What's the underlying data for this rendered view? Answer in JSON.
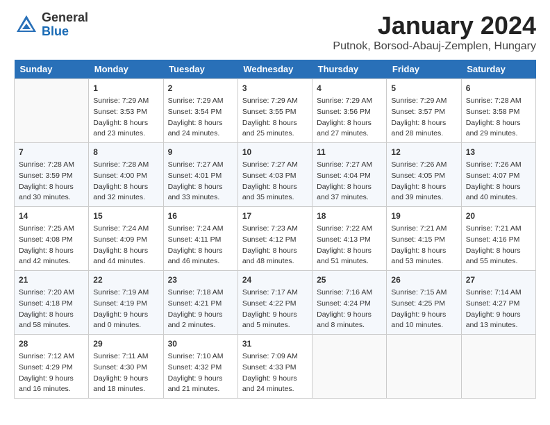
{
  "header": {
    "logo_general": "General",
    "logo_blue": "Blue",
    "month": "January 2024",
    "location": "Putnok, Borsod-Abauj-Zemplen, Hungary"
  },
  "weekdays": [
    "Sunday",
    "Monday",
    "Tuesday",
    "Wednesday",
    "Thursday",
    "Friday",
    "Saturday"
  ],
  "weeks": [
    [
      {
        "day": "",
        "sunrise": "",
        "sunset": "",
        "daylight": ""
      },
      {
        "day": "1",
        "sunrise": "Sunrise: 7:29 AM",
        "sunset": "Sunset: 3:53 PM",
        "daylight": "Daylight: 8 hours and 23 minutes."
      },
      {
        "day": "2",
        "sunrise": "Sunrise: 7:29 AM",
        "sunset": "Sunset: 3:54 PM",
        "daylight": "Daylight: 8 hours and 24 minutes."
      },
      {
        "day": "3",
        "sunrise": "Sunrise: 7:29 AM",
        "sunset": "Sunset: 3:55 PM",
        "daylight": "Daylight: 8 hours and 25 minutes."
      },
      {
        "day": "4",
        "sunrise": "Sunrise: 7:29 AM",
        "sunset": "Sunset: 3:56 PM",
        "daylight": "Daylight: 8 hours and 27 minutes."
      },
      {
        "day": "5",
        "sunrise": "Sunrise: 7:29 AM",
        "sunset": "Sunset: 3:57 PM",
        "daylight": "Daylight: 8 hours and 28 minutes."
      },
      {
        "day": "6",
        "sunrise": "Sunrise: 7:28 AM",
        "sunset": "Sunset: 3:58 PM",
        "daylight": "Daylight: 8 hours and 29 minutes."
      }
    ],
    [
      {
        "day": "7",
        "sunrise": "Sunrise: 7:28 AM",
        "sunset": "Sunset: 3:59 PM",
        "daylight": "Daylight: 8 hours and 30 minutes."
      },
      {
        "day": "8",
        "sunrise": "Sunrise: 7:28 AM",
        "sunset": "Sunset: 4:00 PM",
        "daylight": "Daylight: 8 hours and 32 minutes."
      },
      {
        "day": "9",
        "sunrise": "Sunrise: 7:27 AM",
        "sunset": "Sunset: 4:01 PM",
        "daylight": "Daylight: 8 hours and 33 minutes."
      },
      {
        "day": "10",
        "sunrise": "Sunrise: 7:27 AM",
        "sunset": "Sunset: 4:03 PM",
        "daylight": "Daylight: 8 hours and 35 minutes."
      },
      {
        "day": "11",
        "sunrise": "Sunrise: 7:27 AM",
        "sunset": "Sunset: 4:04 PM",
        "daylight": "Daylight: 8 hours and 37 minutes."
      },
      {
        "day": "12",
        "sunrise": "Sunrise: 7:26 AM",
        "sunset": "Sunset: 4:05 PM",
        "daylight": "Daylight: 8 hours and 39 minutes."
      },
      {
        "day": "13",
        "sunrise": "Sunrise: 7:26 AM",
        "sunset": "Sunset: 4:07 PM",
        "daylight": "Daylight: 8 hours and 40 minutes."
      }
    ],
    [
      {
        "day": "14",
        "sunrise": "Sunrise: 7:25 AM",
        "sunset": "Sunset: 4:08 PM",
        "daylight": "Daylight: 8 hours and 42 minutes."
      },
      {
        "day": "15",
        "sunrise": "Sunrise: 7:24 AM",
        "sunset": "Sunset: 4:09 PM",
        "daylight": "Daylight: 8 hours and 44 minutes."
      },
      {
        "day": "16",
        "sunrise": "Sunrise: 7:24 AM",
        "sunset": "Sunset: 4:11 PM",
        "daylight": "Daylight: 8 hours and 46 minutes."
      },
      {
        "day": "17",
        "sunrise": "Sunrise: 7:23 AM",
        "sunset": "Sunset: 4:12 PM",
        "daylight": "Daylight: 8 hours and 48 minutes."
      },
      {
        "day": "18",
        "sunrise": "Sunrise: 7:22 AM",
        "sunset": "Sunset: 4:13 PM",
        "daylight": "Daylight: 8 hours and 51 minutes."
      },
      {
        "day": "19",
        "sunrise": "Sunrise: 7:21 AM",
        "sunset": "Sunset: 4:15 PM",
        "daylight": "Daylight: 8 hours and 53 minutes."
      },
      {
        "day": "20",
        "sunrise": "Sunrise: 7:21 AM",
        "sunset": "Sunset: 4:16 PM",
        "daylight": "Daylight: 8 hours and 55 minutes."
      }
    ],
    [
      {
        "day": "21",
        "sunrise": "Sunrise: 7:20 AM",
        "sunset": "Sunset: 4:18 PM",
        "daylight": "Daylight: 8 hours and 58 minutes."
      },
      {
        "day": "22",
        "sunrise": "Sunrise: 7:19 AM",
        "sunset": "Sunset: 4:19 PM",
        "daylight": "Daylight: 9 hours and 0 minutes."
      },
      {
        "day": "23",
        "sunrise": "Sunrise: 7:18 AM",
        "sunset": "Sunset: 4:21 PM",
        "daylight": "Daylight: 9 hours and 2 minutes."
      },
      {
        "day": "24",
        "sunrise": "Sunrise: 7:17 AM",
        "sunset": "Sunset: 4:22 PM",
        "daylight": "Daylight: 9 hours and 5 minutes."
      },
      {
        "day": "25",
        "sunrise": "Sunrise: 7:16 AM",
        "sunset": "Sunset: 4:24 PM",
        "daylight": "Daylight: 9 hours and 8 minutes."
      },
      {
        "day": "26",
        "sunrise": "Sunrise: 7:15 AM",
        "sunset": "Sunset: 4:25 PM",
        "daylight": "Daylight: 9 hours and 10 minutes."
      },
      {
        "day": "27",
        "sunrise": "Sunrise: 7:14 AM",
        "sunset": "Sunset: 4:27 PM",
        "daylight": "Daylight: 9 hours and 13 minutes."
      }
    ],
    [
      {
        "day": "28",
        "sunrise": "Sunrise: 7:12 AM",
        "sunset": "Sunset: 4:29 PM",
        "daylight": "Daylight: 9 hours and 16 minutes."
      },
      {
        "day": "29",
        "sunrise": "Sunrise: 7:11 AM",
        "sunset": "Sunset: 4:30 PM",
        "daylight": "Daylight: 9 hours and 18 minutes."
      },
      {
        "day": "30",
        "sunrise": "Sunrise: 7:10 AM",
        "sunset": "Sunset: 4:32 PM",
        "daylight": "Daylight: 9 hours and 21 minutes."
      },
      {
        "day": "31",
        "sunrise": "Sunrise: 7:09 AM",
        "sunset": "Sunset: 4:33 PM",
        "daylight": "Daylight: 9 hours and 24 minutes."
      },
      {
        "day": "",
        "sunrise": "",
        "sunset": "",
        "daylight": ""
      },
      {
        "day": "",
        "sunrise": "",
        "sunset": "",
        "daylight": ""
      },
      {
        "day": "",
        "sunrise": "",
        "sunset": "",
        "daylight": ""
      }
    ]
  ]
}
